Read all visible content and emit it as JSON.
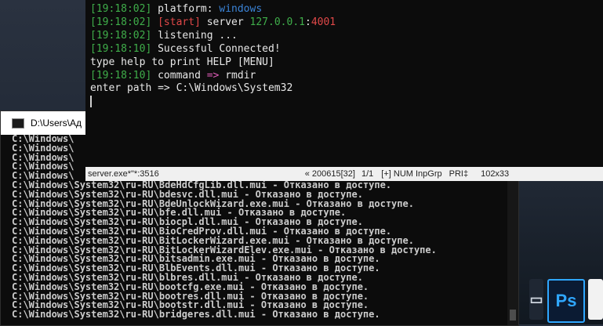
{
  "terminal": {
    "lines": [
      {
        "ts": "[19:18:02]",
        "parts": [
          {
            "t": " platform: ",
            "c": "w"
          },
          {
            "t": "windows",
            "c": "b"
          }
        ]
      },
      {
        "ts": "[19:18:02]",
        "parts": [
          {
            "t": " ",
            "c": "w"
          },
          {
            "t": "[start]",
            "c": "r"
          },
          {
            "t": " server ",
            "c": "w"
          },
          {
            "t": "127.0.0.1",
            "c": "g"
          },
          {
            "t": ":",
            "c": "w"
          },
          {
            "t": "4001",
            "c": "r"
          }
        ]
      },
      {
        "ts": "[19:18:02]",
        "parts": [
          {
            "t": " listening ...",
            "c": "w"
          }
        ]
      },
      {
        "ts": "[19:18:10]",
        "parts": [
          {
            "t": " Sucessful Connected!",
            "c": "w"
          }
        ]
      },
      {
        "ts": "",
        "parts": [
          {
            "t": "type help to print HELP [MENU]",
            "c": "w"
          }
        ]
      },
      {
        "ts": "[19:18:10]",
        "parts": [
          {
            "t": " command ",
            "c": "w"
          },
          {
            "t": "=>",
            "c": "p"
          },
          {
            "t": " rmdir",
            "c": "w"
          }
        ]
      },
      {
        "ts": "",
        "parts": [
          {
            "t": "enter path => C:\\Windows\\System32",
            "c": "w"
          }
        ]
      }
    ]
  },
  "statusbar": {
    "process": "server.exe*\"*:3516",
    "pos": "« 200615[32]",
    "page": "1/1",
    "mode": "[+] NUM InpGrp",
    "pri": "PRI‡",
    "size": "102x33"
  },
  "cmd": {
    "title": "D:\\Users\\Ад",
    "top_lines": [
      "C:\\Windows\\",
      "C:\\Windows\\",
      "C:\\Windows\\",
      "C:\\Windows\\",
      "C:\\Windows\\"
    ],
    "lines": [
      "C:\\Windows\\System32\\ru-RU\\BdeHdCfgLib.dll.mui - Отказано в доступе.",
      "C:\\Windows\\System32\\ru-RU\\bdesvc.dll.mui - Отказано в доступе.",
      "C:\\Windows\\System32\\ru-RU\\BdeUnlockWizard.exe.mui - Отказано в доступе.",
      "C:\\Windows\\System32\\ru-RU\\bfe.dll.mui - Отказано в доступе.",
      "C:\\Windows\\System32\\ru-RU\\biocpl.dll.mui - Отказано в доступе.",
      "C:\\Windows\\System32\\ru-RU\\BioCredProv.dll.mui - Отказано в доступе.",
      "C:\\Windows\\System32\\ru-RU\\BitLockerWizard.exe.mui - Отказано в доступе.",
      "C:\\Windows\\System32\\ru-RU\\BitLockerWizardElev.exe.mui - Отказано в доступе.",
      "C:\\Windows\\System32\\ru-RU\\bitsadmin.exe.mui - Отказано в доступе.",
      "C:\\Windows\\System32\\ru-RU\\BlbEvents.dll.mui - Отказано в доступе.",
      "C:\\Windows\\System32\\ru-RU\\blbres.dll.mui - Отказано в доступе.",
      "C:\\Windows\\System32\\ru-RU\\bootcfg.exe.mui - Отказано в доступе.",
      "C:\\Windows\\System32\\ru-RU\\bootres.dll.mui - Отказано в доступе.",
      "C:\\Windows\\System32\\ru-RU\\bootstr.dll.mui - Отказано в доступе.",
      "C:\\Windows\\System32\\ru-RU\\bridgeres.dll.mui - Отказано в доступе."
    ]
  },
  "desktop": {
    "ps_label": "Ps"
  }
}
